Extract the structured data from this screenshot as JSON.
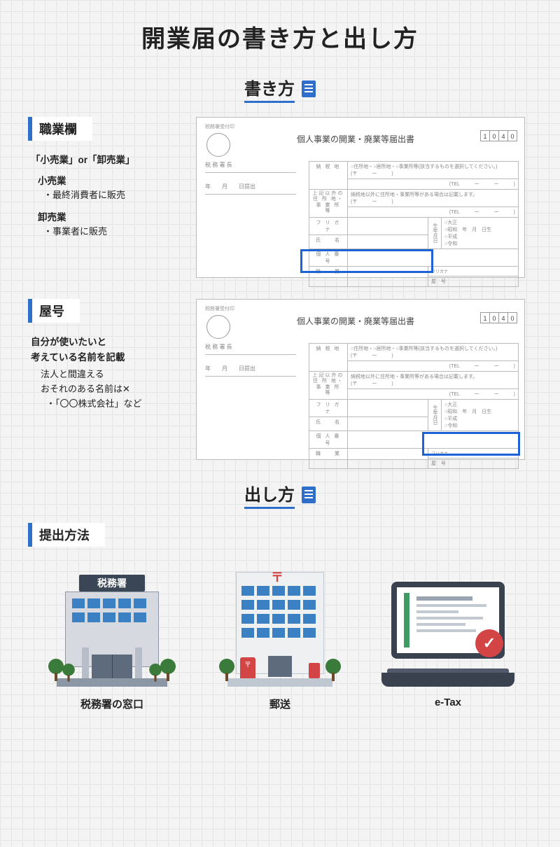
{
  "title": "開業届の書き方と出し方",
  "section1_heading": "書き方",
  "section2_heading": "出し方",
  "occupation": {
    "tag": "職業欄",
    "subhead": "「小売業」or「卸売業」",
    "retail_label": "小売業",
    "retail_desc": "・最終消費者に販売",
    "wholesale_label": "卸売業",
    "wholesale_desc": "・事業者に販売"
  },
  "tradename": {
    "tag": "屋号",
    "subhead1": "自分が使いたいと",
    "subhead2": "考えている名前を記載",
    "note1": "法人と間違える",
    "note2": "おそれのある名前は✕",
    "note3": "・「〇〇株式会社」など"
  },
  "form": {
    "title": "個人事業の開業・廃業等届出書",
    "code": [
      "1",
      "0",
      "4",
      "0"
    ],
    "stamp_label": "税務署受付印",
    "line1": "税 務 署 長",
    "line2": "年　　月　　日提出",
    "row_label_nozeichi": "納 税 地",
    "nozeichi_note": "○住所地・○居所地・○事業所等(該当するものを選択してください。)",
    "yubin": "(〒　　　ー　　　)",
    "tel": "(TEL　　　ー　　　ー　　　)",
    "row_label_igai": "上記以外の\n住 所 地・\n事 業 所 等",
    "igai_note": "納税地以外に住所地・事業所等がある場合は記載します。",
    "row_label_furigana": "フ リ ガ ナ",
    "row_label_shimei": "氏　　名",
    "birth_label": "生年月日",
    "era1": "○大正",
    "era2": "○昭和",
    "era3": "○平成",
    "era4": "○令和",
    "birth_suffix": "年　月　日生",
    "row_label_kojin": "個 人 番 号",
    "row_label_shokugyo": "職　　業",
    "row_label_yago_f": "フリガナ",
    "row_label_yago": "屋　号"
  },
  "submission": {
    "tag": "提出方法",
    "tax_sign": "税務署",
    "method1": "税務署の窓口",
    "method2": "郵送",
    "method3": "e-Tax"
  }
}
